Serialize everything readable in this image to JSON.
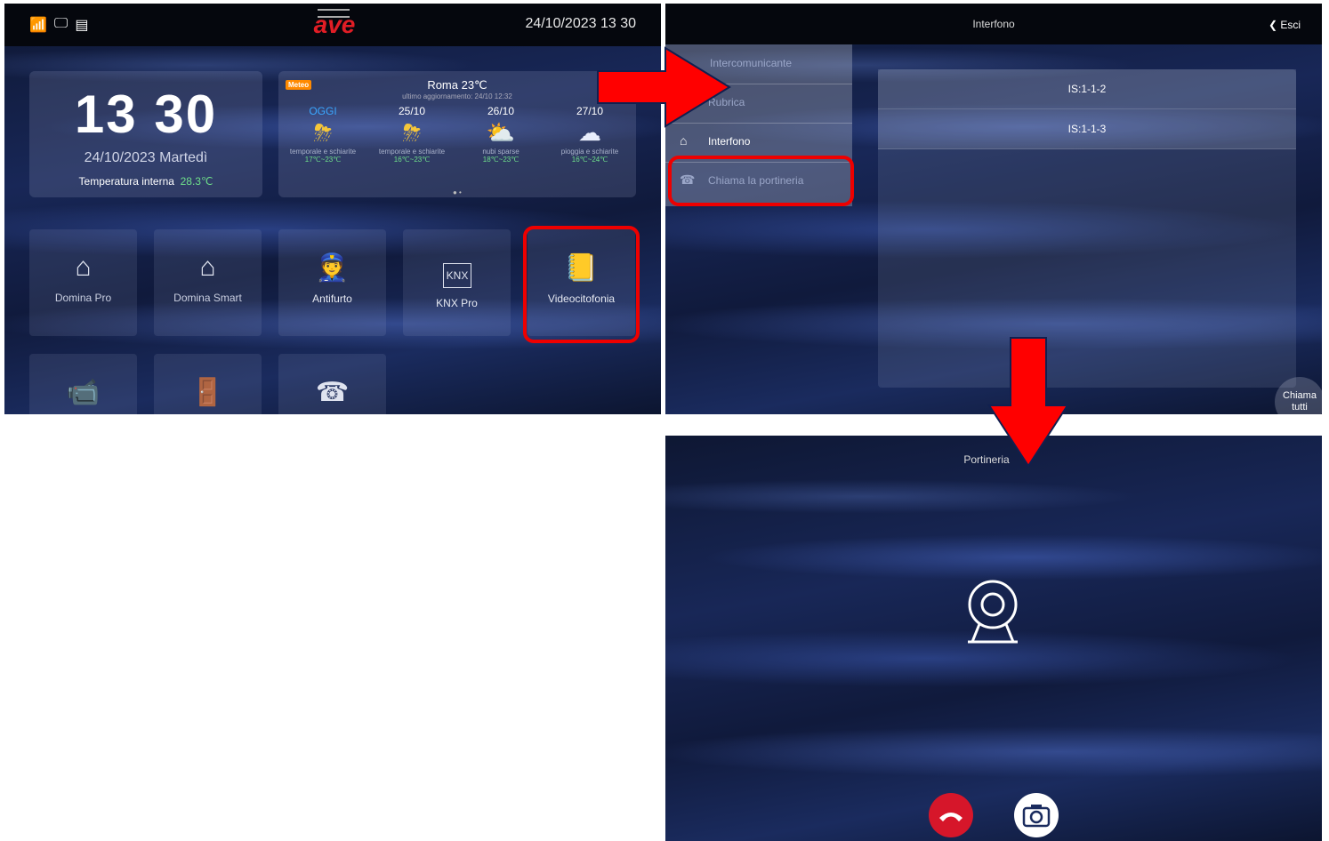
{
  "home": {
    "time": "13 30",
    "date_label": "24/10/2023 Martedì",
    "temp_label": "Temperatura interna",
    "temp_value": "28.3℃",
    "header_datetime": "24/10/2023   13 30",
    "logo": "ave",
    "weather": {
      "badge": "Meteo",
      "city": "Roma 23℃",
      "updated": "ultimo aggiornamento: 24/10 12:32",
      "days": [
        {
          "day": "OGGI",
          "desc": "temporale e schiarite",
          "range": "17℃~23℃",
          "icon": "storm-sun-icon"
        },
        {
          "day": "25/10",
          "desc": "temporale e schiarite",
          "range": "16℃~23℃",
          "icon": "storm-sun-icon"
        },
        {
          "day": "26/10",
          "desc": "nubi sparse",
          "range": "18℃~23℃",
          "icon": "cloud-sun-icon"
        },
        {
          "day": "27/10",
          "desc": "pioggia e schiarite",
          "range": "16℃~24℃",
          "icon": "rain-sun-icon"
        }
      ]
    },
    "tiles": [
      {
        "label": "Domina Pro",
        "icon": "house-icon"
      },
      {
        "label": "Domina Smart",
        "icon": "smart-house-icon"
      },
      {
        "label": "Antifurto",
        "icon": "guard-icon"
      },
      {
        "label": "KNX Pro",
        "icon": "knx-icon"
      },
      {
        "label": "Videocitofonia",
        "icon": "address-book-icon"
      },
      {
        "label": "",
        "icon": "camera-cctv-icon"
      },
      {
        "label": "",
        "icon": "door-icon"
      },
      {
        "label": "",
        "icon": "phone-doc-icon"
      }
    ]
  },
  "intercom": {
    "title": "Interfono",
    "back": "Esci",
    "menu": [
      "Intercomunicante",
      "Rubrica",
      "Interfono",
      "Chiama la portineria"
    ],
    "list": [
      "IS:1-1-2",
      "IS:1-1-3"
    ],
    "call_all_line1": "Chiama",
    "call_all_line2": "tutti"
  },
  "call": {
    "title": "Portineria"
  },
  "colors": {
    "highlight": "#e00000",
    "arrow": "#ff0000",
    "hangup": "#d6162a",
    "accent_green": "#6fe08b"
  }
}
